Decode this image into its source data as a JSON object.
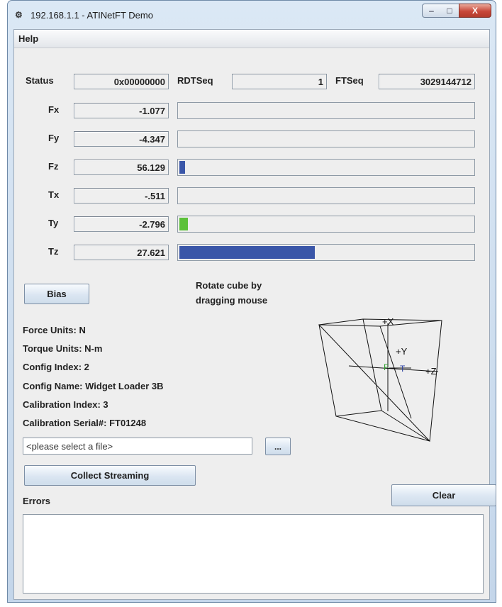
{
  "window": {
    "title": "192.168.1.1 - ATINetFT Demo",
    "controls": {
      "minimize": "–",
      "maximize": "□",
      "close": "X"
    }
  },
  "menu": {
    "items": [
      "Help"
    ]
  },
  "status_row": {
    "status_label": "Status",
    "status_value": "0x00000000",
    "rdtseq_label": "RDTSeq",
    "rdtseq_value": "1",
    "ftseq_label": "FTSeq",
    "ftseq_value": "3029144712"
  },
  "channels": [
    {
      "label": "Fx",
      "value": "-1.077",
      "level": 0.0,
      "color": "#3a56a8"
    },
    {
      "label": "Fy",
      "value": "-4.347",
      "level": 0.0,
      "color": "#3a56a8"
    },
    {
      "label": "Fz",
      "value": "56.129",
      "level": 0.02,
      "color": "#3a56a8"
    },
    {
      "label": "Tx",
      "value": "-.511",
      "level": 0.0,
      "color": "#3a56a8"
    },
    {
      "label": "Ty",
      "value": "-2.796",
      "level": 0.03,
      "color": "#5cc13a"
    },
    {
      "label": "Tz",
      "value": "27.621",
      "level": 0.46,
      "color": "#3a56a8"
    }
  ],
  "bias_button": "Bias",
  "rotate_hint": [
    "Rotate cube by",
    "dragging mouse"
  ],
  "info": {
    "force_units": "Force Units: N",
    "torque_units": "Torque Units: N-m",
    "config_index": "Config Index: 2",
    "config_name": "Config Name: Widget Loader 3B",
    "calibration_index": "Calibration Index: 3",
    "calibration_serial": "Calibration Serial#: FT01248"
  },
  "file": {
    "value": "<please select a file>",
    "browse_label": "..."
  },
  "collect_button": "Collect Streaming",
  "clear_button": "Clear",
  "errors_label": "Errors",
  "cube": {
    "x_label": "+X",
    "y_label": "+Y",
    "z_label": "+Z",
    "small_labels": [
      "F",
      "T"
    ]
  }
}
